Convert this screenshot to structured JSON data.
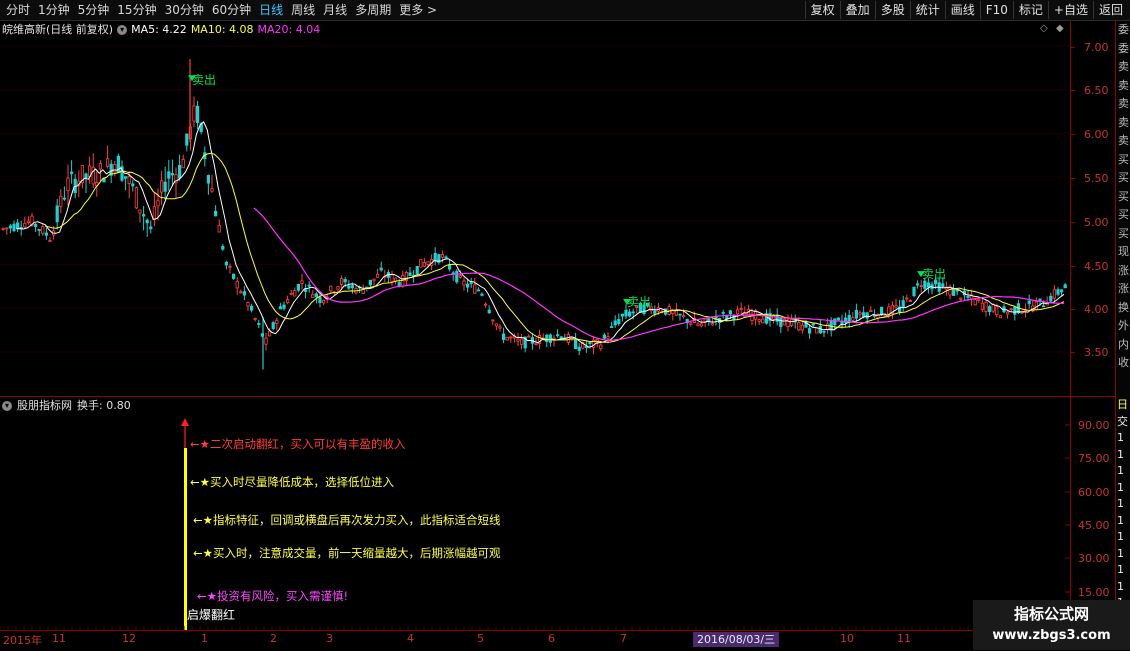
{
  "toolbar": {
    "periods": [
      "分时",
      "1分钟",
      "5分钟",
      "15分钟",
      "30分钟",
      "60分钟",
      "日线",
      "周线",
      "月线",
      "多周期",
      "更多 >"
    ],
    "active_period": "日线",
    "buttons": [
      "复权",
      "叠加",
      "多股",
      "统计",
      "画线",
      "F10",
      "标记",
      "+自选",
      "返回"
    ]
  },
  "stock": {
    "name": "皖维高新(日线 前复权)",
    "ma5": "MA5: 4.22",
    "ma10": "MA10: 4.08",
    "ma20": "MA20: 4.04"
  },
  "price_axis": [
    "7.00",
    "6.50",
    "6.00",
    "5.50",
    "5.00",
    "4.50",
    "4.00",
    "3.50"
  ],
  "indicator": {
    "name": "股朋指标网",
    "turnover": "换手: 0.80",
    "axis": [
      "90.00",
      "75.00",
      "60.00",
      "45.00",
      "30.00",
      "15.00"
    ],
    "notes": [
      {
        "text": "←★二次启动翻红，买入可以有丰盈的收入",
        "color": "#ff3b3b"
      },
      {
        "text": "←★买入时尽量降低成本，选择低位进入",
        "color": "#ffff44"
      },
      {
        "text": "←★指标特征，回调或横盘后再次发力买入，此指标适合短线",
        "color": "#ffff44"
      },
      {
        "text": "←★买入时，注意成交量，前一天缩量越大，后期涨幅越可观",
        "color": "#ffff44"
      },
      {
        "text": "←★投资有风险，买入需谨慎!",
        "color": "#ff44ff"
      }
    ],
    "bar_label": "启爆翻红"
  },
  "signals": [
    "卖出",
    "卖出",
    "卖出"
  ],
  "right_panel": {
    "top_chars": [
      "委",
      "委",
      "卖",
      "卖",
      "卖",
      "卖",
      "卖",
      "买",
      "买",
      "买",
      "买",
      "买",
      "现",
      "涨",
      "涨",
      "换",
      "外",
      "内",
      "收"
    ],
    "bottom_chars": [
      "日",
      "交",
      "1",
      "1",
      "1",
      "1",
      "1",
      "1",
      "1",
      "1",
      "1",
      "1",
      "1",
      "1"
    ]
  },
  "date_axis": {
    "labels": [
      "2015年",
      "11",
      "12",
      "1",
      "2",
      "3",
      "4",
      "5",
      "6",
      "7",
      "10",
      "11"
    ],
    "highlight": "2016/08/03/三"
  },
  "watermark": {
    "title": "指标公式网",
    "url": "www.zbgs3.com"
  },
  "chart_data": {
    "type": "candlestick",
    "price_range": [
      3.1,
      7.1
    ],
    "ma_series": [
      {
        "name": "MA5",
        "color": "#ffffff"
      },
      {
        "name": "MA10",
        "color": "#ffff33"
      },
      {
        "name": "MA20",
        "color": "#ff33ff"
      }
    ]
  }
}
